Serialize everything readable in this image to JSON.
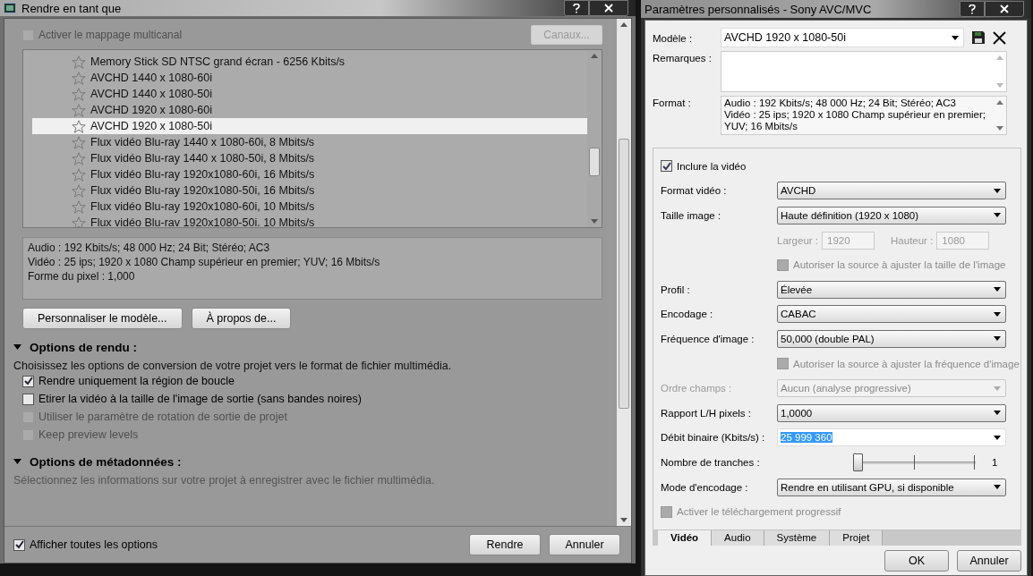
{
  "left_window": {
    "title": "Rendre en tant que",
    "multichannel": {
      "label": "Activer le mappage multicanal",
      "checked": false,
      "disabled": true
    },
    "channels_button": {
      "label": "Canaux...",
      "disabled": true
    },
    "presets": [
      {
        "label": "Memory Stick SD NTSC grand écran - 6256 Kbits/s",
        "selected": false
      },
      {
        "label": "AVCHD 1440 x 1080-60i",
        "selected": false
      },
      {
        "label": "AVCHD 1440 x 1080-50i",
        "selected": false
      },
      {
        "label": "AVCHD 1920 x 1080-60i",
        "selected": false
      },
      {
        "label": "AVCHD 1920 x 1080-50i",
        "selected": true
      },
      {
        "label": "Flux vidéo Blu-ray 1440 x 1080-60i, 8 Mbits/s",
        "selected": false
      },
      {
        "label": "Flux vidéo Blu-ray 1440 x 1080-50i, 8 Mbits/s",
        "selected": false
      },
      {
        "label": "Flux vidéo Blu-ray 1920x1080-60i, 16 Mbits/s",
        "selected": false
      },
      {
        "label": "Flux vidéo Blu-ray 1920x1080-50i, 16 Mbits/s",
        "selected": false
      },
      {
        "label": "Flux vidéo Blu-ray 1920x1080-60i, 10 Mbits/s",
        "selected": false
      },
      {
        "label": "Flux vidéo Blu-rav 1920x1080-50i. 10 Mbits/s",
        "selected": false
      }
    ],
    "description": [
      "Audio : 192 Kbits/s; 48 000 Hz; 24 Bit; Stéréo; AC3",
      "Vidéo : 25 ips; 1920 x 1080 Champ supérieur en premier; YUV; 16 Mbits/s",
      "Forme du pixel : 1,000"
    ],
    "buttons": [
      "Personnaliser le modèle...",
      "À propos de..."
    ],
    "sections": [
      {
        "title": "Options de rendu :",
        "expanded": true,
        "text": "Choisissez les options de conversion de votre projet vers le format de fichier multimédia.",
        "text_disabled": false,
        "options": [
          {
            "label": "Rendre uniquement la région de boucle",
            "checked": true,
            "disabled": false
          },
          {
            "label": "Etirer la vidéo à la taille de l'image de sortie (sans bandes noires)",
            "checked": false,
            "disabled": false
          },
          {
            "label": "Utiliser le paramètre de rotation de sortie de projet",
            "checked": false,
            "disabled": true
          },
          {
            "label": "Keep preview levels",
            "checked": false,
            "disabled": true
          }
        ]
      },
      {
        "title": "Options de métadonnées :",
        "expanded": true,
        "text": "Sélectionnez les informations sur votre projet à enregistrer avec le fichier multimédia.",
        "text_disabled": true
      }
    ],
    "show_all": {
      "label": "Afficher toutes les options",
      "checked": true
    },
    "footer_buttons": [
      "Rendre",
      "Annuler"
    ]
  },
  "right_window": {
    "title": "Paramètres personnalisés - Sony AVC/MVC",
    "template": {
      "label": "Modèle :",
      "value": "AVCHD 1920 x 1080-50i"
    },
    "remarks": {
      "label": "Remarques :"
    },
    "format": {
      "label": "Format :",
      "lines": [
        "Audio : 192 Kbits/s; 48 000 Hz; 24 Bit; Stéréo; AC3",
        "Vidéo : 25 ips; 1920 x 1080 Champ supérieur en premier; YUV; 16 Mbits/s"
      ]
    },
    "include_video": {
      "label": "Inclure la vidéo",
      "checked": true
    },
    "rows": [
      {
        "kind": "select",
        "label": "Format vidéo :",
        "value": "AVCHD",
        "disabled": false
      },
      {
        "kind": "select",
        "label": "Taille image :",
        "value": "Haute définition (1920 x 1080)",
        "disabled": false
      },
      {
        "kind": "size",
        "width_label": "Largeur :",
        "width_value": "1920",
        "height_label": "Hauteur :",
        "height_value": "1080",
        "disabled": true
      },
      {
        "kind": "checkbox",
        "label": "Autoriser la source à ajuster la taille de l'image",
        "checked": false,
        "disabled": true
      },
      {
        "kind": "select",
        "label": "Profil :",
        "value": "Élevée",
        "disabled": false
      },
      {
        "kind": "select",
        "label": "Encodage :",
        "value": "CABAC",
        "disabled": false
      },
      {
        "kind": "select",
        "label": "Fréquence d'image :",
        "value": "50,000 (double PAL)",
        "disabled": false
      },
      {
        "kind": "checkbox",
        "label": "Autoriser la source à ajuster la fréquence d'image",
        "checked": false,
        "disabled": true
      },
      {
        "kind": "select",
        "label": "Ordre champs :",
        "value": "Aucun (analyse progressive)",
        "disabled": true
      },
      {
        "kind": "select",
        "label": "Rapport L/H pixels :",
        "value": "1,0000",
        "disabled": false
      },
      {
        "kind": "combo",
        "label": "Débit binaire (Kbits/s) :",
        "value": "25 999 360",
        "text_selected": true
      },
      {
        "kind": "slider",
        "label": "Nombre de tranches :",
        "level": 0,
        "reading": "1"
      },
      {
        "kind": "select",
        "label": "Mode d'encodage :",
        "value": "Rendre en utilisant GPU, si disponible",
        "disabled": false
      },
      {
        "kind": "wide_checkbox",
        "label": "Activer le téléchargement progressif",
        "checked": false,
        "disabled": true
      }
    ],
    "tabs": [
      {
        "label": "Vidéo",
        "selected": true
      },
      {
        "label": "Audio",
        "selected": false
      },
      {
        "label": "Système",
        "selected": false
      },
      {
        "label": "Projet",
        "selected": false
      }
    ],
    "buttons": [
      "OK",
      "Annuler"
    ]
  }
}
